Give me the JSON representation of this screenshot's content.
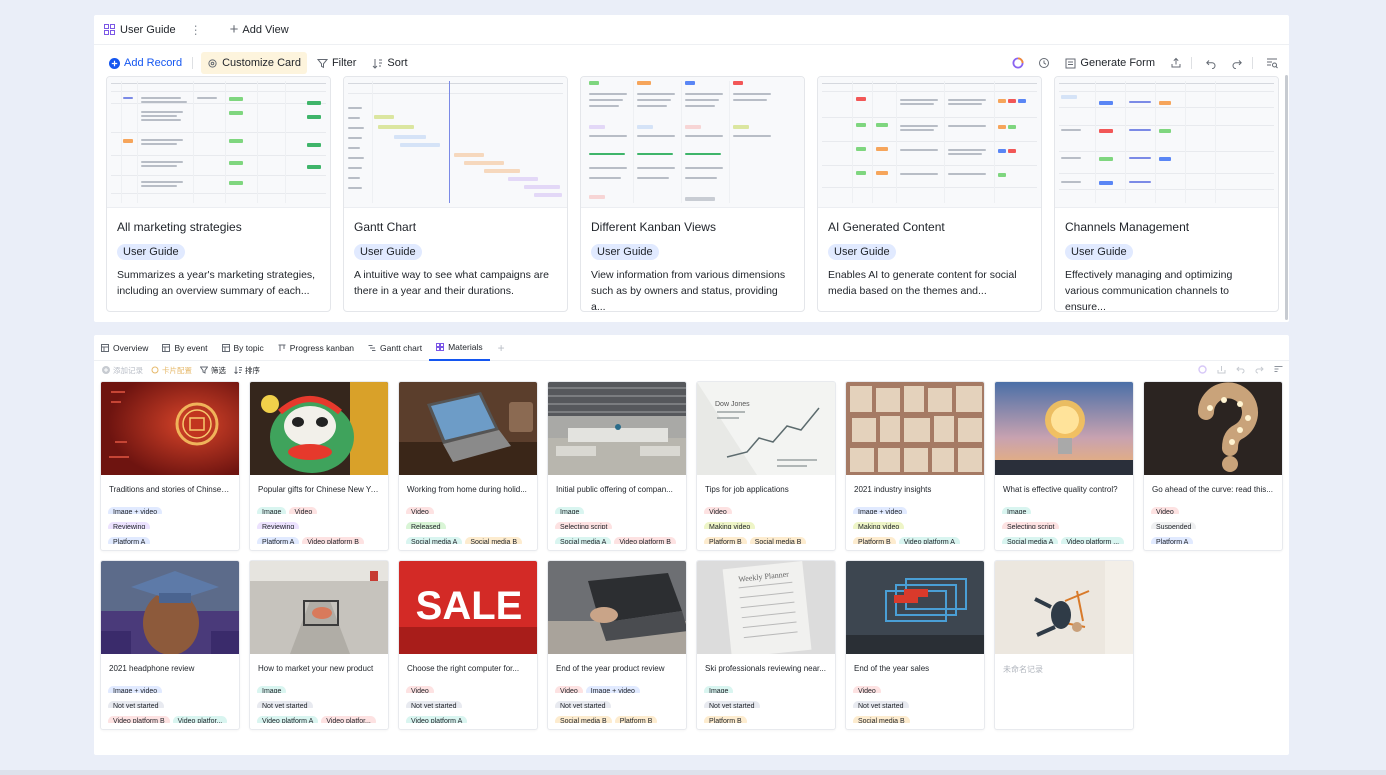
{
  "top": {
    "view_tab": "User Guide",
    "more": "⋮",
    "add_view": "Add View",
    "toolbar": {
      "add_record": "Add Record",
      "customize_card": "Customize Card",
      "filter": "Filter",
      "sort": "Sort",
      "generate_form": "Generate Form"
    },
    "cards": [
      {
        "title": "All marketing strategies",
        "tag": "User Guide",
        "desc": "Summarizes a year's  marketing strategies, including an overview summary of each..."
      },
      {
        "title": "Gantt Chart",
        "tag": "User Guide",
        "desc": "A intuitive way to see what campaigns are there in a year and their durations."
      },
      {
        "title": "Different Kanban Views",
        "tag": "User Guide",
        "desc": "View information from various dimensions such as by owners and status, providing a..."
      },
      {
        "title": "AI Generated Content",
        "tag": "User Guide",
        "desc": "Enables AI to generate content for social media based on the themes and..."
      },
      {
        "title": "Channels Management",
        "tag": "User Guide",
        "desc": "Effectively managing and optimizing various communication channels to ensure..."
      }
    ]
  },
  "bottom": {
    "tabs": [
      "Overview",
      "By event",
      "By topic",
      "Progress kanban",
      "Gantt chart",
      "Materials"
    ],
    "add_tab": "+",
    "toolbar": {
      "add": "添加记录",
      "custom": "卡片配置",
      "filter": "筛选",
      "sort": "排序"
    },
    "cards": [
      {
        "title": "Traditions and stories of Chinses...",
        "rows": [
          [
            {
              "t": "Image + video",
              "c": "#e1eaff"
            }
          ],
          [
            {
              "t": "Reviewing",
              "c": "#ece2fe"
            }
          ],
          [
            {
              "t": "Platform A",
              "c": "#e1eaff"
            }
          ]
        ],
        "cover": "lantern"
      },
      {
        "title": "Popular gifts for Chinese New Ye...",
        "rows": [
          [
            {
              "t": "Image",
              "c": "#d9f5f0"
            },
            {
              "t": "Video",
              "c": "#fde2e2"
            }
          ],
          [
            {
              "t": "Reviewing",
              "c": "#ece2fe"
            }
          ],
          [
            {
              "t": "Platform A",
              "c": "#e1eaff"
            },
            {
              "t": "Video platform B",
              "c": "#fde2e2"
            }
          ]
        ],
        "cover": "lion"
      },
      {
        "title": "Working from home during holid...",
        "rows": [
          [
            {
              "t": "Video",
              "c": "#fde2e2"
            }
          ],
          [
            {
              "t": "Released",
              "c": "#d9f5d6"
            }
          ],
          [
            {
              "t": "Social media A",
              "c": "#d9f5f0"
            },
            {
              "t": "Social media B",
              "c": "#fdeccf"
            }
          ]
        ],
        "cover": "laptop"
      },
      {
        "title": "Initial public offering of compan...",
        "rows": [
          [
            {
              "t": "Image",
              "c": "#d9f5f0"
            }
          ],
          [
            {
              "t": "Selecting script",
              "c": "#fde2e2"
            }
          ],
          [
            {
              "t": "Social media A",
              "c": "#d9f5f0"
            },
            {
              "t": "Video platform B",
              "c": "#fde2e2"
            }
          ]
        ],
        "cover": "office"
      },
      {
        "title": "Tips for job applications",
        "rows": [
          [
            {
              "t": "Video",
              "c": "#fde2e2"
            }
          ],
          [
            {
              "t": "Making video",
              "c": "#eef5c7"
            }
          ],
          [
            {
              "t": "Platform B",
              "c": "#fdeccf"
            },
            {
              "t": "Social media B",
              "c": "#fdeccf"
            }
          ]
        ],
        "cover": "paper"
      },
      {
        "title": "2021 industry insights",
        "rows": [
          [
            {
              "t": "Image + video",
              "c": "#e1eaff"
            }
          ],
          [
            {
              "t": "Making video",
              "c": "#eef5c7"
            }
          ],
          [
            {
              "t": "Platform B",
              "c": "#fdeccf"
            },
            {
              "t": "Video platform A",
              "c": "#d9f5f0"
            }
          ]
        ],
        "cover": "books"
      },
      {
        "title": "What is effective quality control?",
        "rows": [
          [
            {
              "t": "Image",
              "c": "#d9f5f0"
            }
          ],
          [
            {
              "t": "Selecting script",
              "c": "#fde2e2"
            }
          ],
          [
            {
              "t": "Social media A",
              "c": "#d9f5f0"
            },
            {
              "t": "Video platform ...",
              "c": "#d9f5f0"
            }
          ]
        ],
        "cover": "bulb"
      },
      {
        "title": "Go ahead of the curve: read this...",
        "rows": [
          [
            {
              "t": "Video",
              "c": "#fde2e2"
            }
          ],
          [
            {
              "t": "Suspended",
              "c": "#eff0f1"
            }
          ],
          [
            {
              "t": "Platform A",
              "c": "#e1eaff"
            }
          ]
        ],
        "cover": "question"
      },
      {
        "title": "2021 headphone review",
        "rows": [
          [
            {
              "t": "Image + video",
              "c": "#e1eaff"
            }
          ],
          [
            {
              "t": "Not yet started",
              "c": "#e8eaf0"
            }
          ],
          [
            {
              "t": "Video platform B",
              "c": "#fde2e2"
            },
            {
              "t": "Video platfor...",
              "c": "#d9f5f0"
            }
          ]
        ],
        "cover": "grad"
      },
      {
        "title": "How to market your new product",
        "rows": [
          [
            {
              "t": "Image",
              "c": "#d9f5f0"
            }
          ],
          [
            {
              "t": "Not yet started",
              "c": "#e8eaf0"
            }
          ],
          [
            {
              "t": "Video platform A",
              "c": "#d9f5f0"
            },
            {
              "t": "Video platfor...",
              "c": "#fde2e2"
            }
          ]
        ],
        "cover": "cart"
      },
      {
        "title": "Choose the right computer for...",
        "rows": [
          [
            {
              "t": "Video",
              "c": "#fde2e2"
            }
          ],
          [
            {
              "t": "Not yet started",
              "c": "#e8eaf0"
            }
          ],
          [
            {
              "t": "Video platform A",
              "c": "#d9f5f0"
            }
          ]
        ],
        "cover": "sale"
      },
      {
        "title": "End of the year product review",
        "rows": [
          [
            {
              "t": "Video",
              "c": "#fde2e2"
            },
            {
              "t": "Image + video",
              "c": "#e1eaff"
            }
          ],
          [
            {
              "t": "Not yet started",
              "c": "#e8eaf0"
            }
          ],
          [
            {
              "t": "Social media B",
              "c": "#fdeccf"
            },
            {
              "t": "Platform B",
              "c": "#fdeccf"
            }
          ]
        ],
        "cover": "typing"
      },
      {
        "title": "Ski professionals reviewing near...",
        "rows": [
          [
            {
              "t": "Image",
              "c": "#d9f5f0"
            }
          ],
          [
            {
              "t": "Not yet started",
              "c": "#e8eaf0"
            }
          ],
          [
            {
              "t": "Platform B",
              "c": "#fdeccf"
            }
          ]
        ],
        "cover": "notebook"
      },
      {
        "title": "End of the year sales",
        "rows": [
          [
            {
              "t": "Video",
              "c": "#fde2e2"
            }
          ],
          [
            {
              "t": "Not yet started",
              "c": "#e8eaf0"
            }
          ],
          [
            {
              "t": "Social media B",
              "c": "#fdeccf"
            }
          ]
        ],
        "cover": "carts"
      },
      {
        "title": "未命名记录",
        "rows": [],
        "cover": "jump",
        "placeholder": true
      }
    ]
  }
}
